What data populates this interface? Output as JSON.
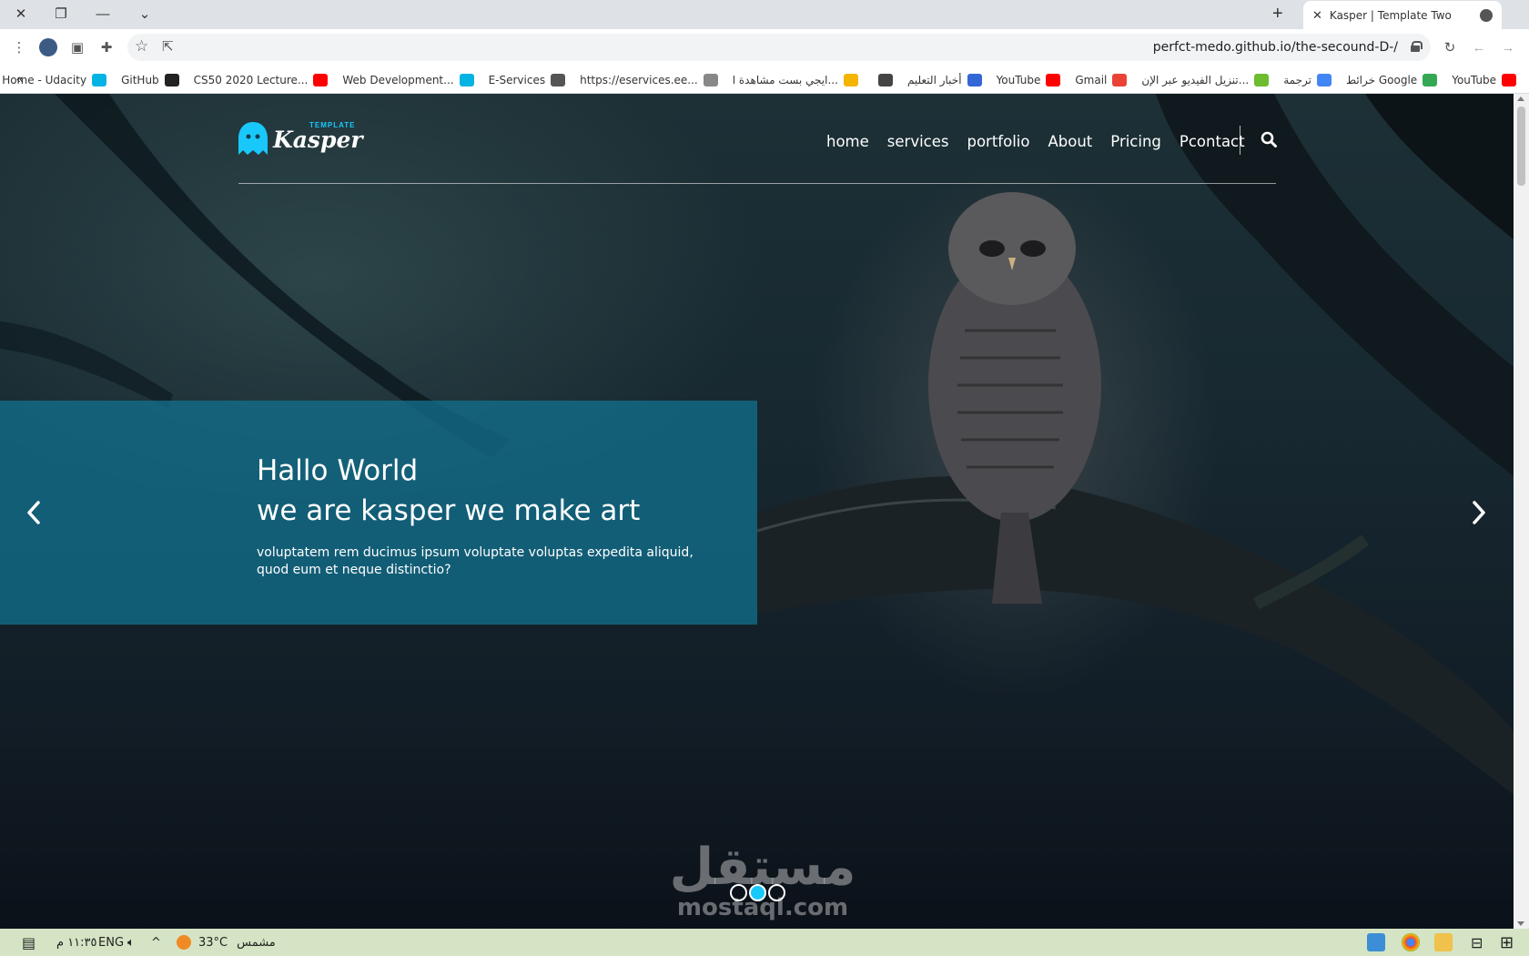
{
  "browser": {
    "tab_title": "Kasper | Template Two",
    "url": "perfct-medo.github.io/the-secound-D-/",
    "bookmarks": [
      {
        "label": "YouTube",
        "icon": "youtube-icon",
        "color": "#ff0000"
      },
      {
        "label": "خرائط Google",
        "icon": "maps-icon",
        "color": "#34a853"
      },
      {
        "label": "ترجمة",
        "icon": "translate-icon",
        "color": "#4285f4"
      },
      {
        "label": "تنزيل الفيديو عبر الإن...",
        "icon": "download-icon",
        "color": "#6dbd2f"
      },
      {
        "label": "Gmail",
        "icon": "gmail-icon",
        "color": "#ea4335"
      },
      {
        "label": "YouTube",
        "icon": "youtube-icon",
        "color": "#ff0000"
      },
      {
        "label": "أخبار التعليم",
        "icon": "globe-icon",
        "color": "#3367d6"
      },
      {
        "label": "",
        "icon": "globe-icon",
        "color": "#444444"
      },
      {
        "label": "ايجي بست مشاهدة ا...",
        "icon": "egybest-icon",
        "color": "#f4b400"
      },
      {
        "label": "https://eservices.ee...",
        "icon": "eservices-icon",
        "color": "#888888"
      },
      {
        "label": "E-Services",
        "icon": "eservices-logo-icon",
        "color": "#555555"
      },
      {
        "label": "Web Development...",
        "icon": "udacity-icon",
        "color": "#02b3e4"
      },
      {
        "label": "CS50 2020 Lecture...",
        "icon": "youtube-icon",
        "color": "#ff0000"
      },
      {
        "label": "GitHub",
        "icon": "github-icon",
        "color": "#222222"
      },
      {
        "label": "Home - Udacity",
        "icon": "udacity-icon",
        "color": "#02b3e4"
      }
    ]
  },
  "site": {
    "logo": {
      "text": "Kasper",
      "tag": "TEMPLATE"
    },
    "nav": [
      "home",
      "services",
      "portfolio",
      "About",
      "Pricing",
      "Pcontact"
    ],
    "slide": {
      "heading_line1": "Hallo World",
      "heading_line2": "we are kasper we make art",
      "text": "voluptatem rem ducimus ipsum voluptate voluptas expedita aliquid, quod eum et neque distinctio?"
    },
    "slider_dots": 3,
    "active_dot": 2
  },
  "watermark": {
    "arabic": "مستقل",
    "latin": "mostaql.com"
  },
  "taskbar": {
    "time": "١١:٣٥ م",
    "language": "ENG",
    "temperature": "33°C",
    "weather": "مشمس"
  },
  "colors": {
    "accent": "#19c8fa",
    "slide_box": "#126e8c"
  }
}
